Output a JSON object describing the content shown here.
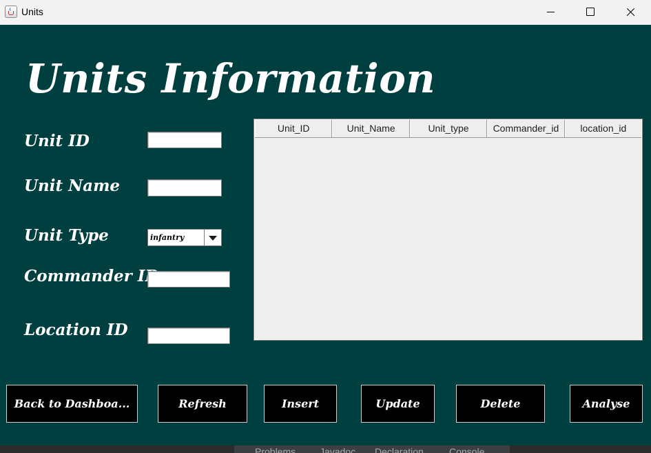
{
  "window": {
    "title": "Units"
  },
  "heading": "Units Information",
  "form": {
    "unit_id_label": "Unit ID",
    "unit_id_value": "",
    "unit_name_label": "Unit Name",
    "unit_name_value": "",
    "unit_type_label": "Unit Type",
    "unit_type_selected": "infantry",
    "commander_id_label": "Commander ID",
    "commander_id_value": "",
    "location_id_label": "Location ID",
    "location_id_value": ""
  },
  "table": {
    "columns": [
      "Unit_ID",
      "Unit_Name",
      "Unit_type",
      "Commander_id",
      "location_id"
    ],
    "rows": []
  },
  "buttons": {
    "back": "Back to Dashboa...",
    "refresh": "Refresh",
    "insert": "Insert",
    "update": "Update",
    "delete": "Delete",
    "analyse": "Analyse"
  },
  "ide_tabs": [
    "Problems",
    "Javadoc",
    "Declaration",
    "Console"
  ],
  "colors": {
    "panel_bg": "#003f40",
    "button_bg": "#000000",
    "text": "#ffffff"
  }
}
